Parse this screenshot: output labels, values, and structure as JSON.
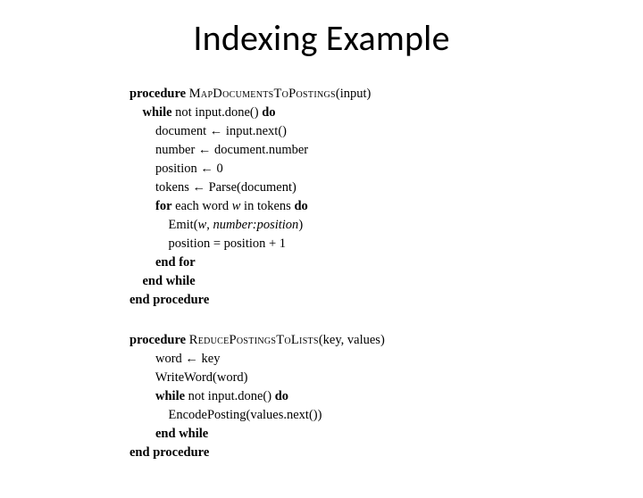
{
  "title": "Indexing Example",
  "kw": {
    "procedure": "procedure",
    "end_procedure": "end procedure",
    "while": "while",
    "end_while": "end while",
    "do": "do",
    "for": "for",
    "end_for": "end for"
  },
  "proc1": {
    "name": "MapDocumentsToPostings",
    "args": "(input)",
    "cond_while": "not input.done() ",
    "l1": "document ← input.next()",
    "l2": "number ← document.number",
    "l3": "position ← 0",
    "l4": "tokens ← Parse(document)",
    "for_each": "each word ",
    "for_var": "w",
    "for_in": " in tokens ",
    "emit_open": "Emit(",
    "emit_w": "w",
    "emit_sep1": ", ",
    "emit_np": "number:position",
    "emit_close": ")",
    "pos_update": "position = position + 1"
  },
  "proc2": {
    "name": "ReducePostingsToLists",
    "args": "(key, values)",
    "l1": "word ← key",
    "l2": "WriteWord(word)",
    "cond_while": "not input.done() ",
    "l3": "EncodePosting(values.next())"
  }
}
